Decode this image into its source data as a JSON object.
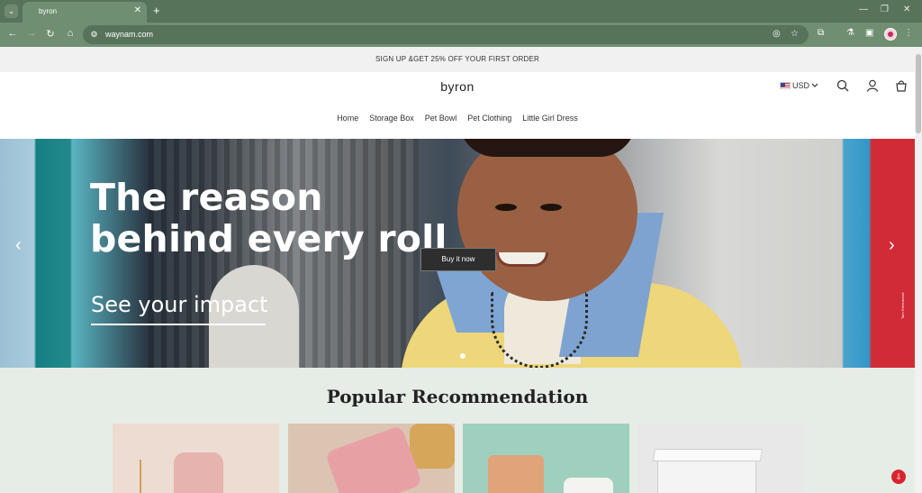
{
  "browser": {
    "tab_title": "byron",
    "url": "waynam.com",
    "new_tab_symbol": "+",
    "close_symbol": "✕"
  },
  "announcement": "SIGN UP &GET 25% OFF YOUR FIRST ORDER",
  "header": {
    "logo": "byron",
    "currency": "USD",
    "icons": [
      "search-icon",
      "account-icon",
      "cart-icon"
    ]
  },
  "nav": {
    "items": [
      {
        "label": "Home"
      },
      {
        "label": "Storage Box"
      },
      {
        "label": "Pet Bowl"
      },
      {
        "label": "Pet Clothing"
      },
      {
        "label": "Little Girl Dress"
      }
    ]
  },
  "hero": {
    "title_line1": "The reason",
    "title_line2": "behind every roll",
    "subtitle": "See your impact",
    "cta": "Buy it now",
    "credit": "Tam Greenwood"
  },
  "recommendation": {
    "title": "Popular Recommendation"
  },
  "colors": {
    "chrome": "#57735a",
    "chrome_active": "#6f8e72",
    "reco_bg": "#e6ede6",
    "cta_bg": "#2e2e2e",
    "chat": "#d9242d"
  }
}
